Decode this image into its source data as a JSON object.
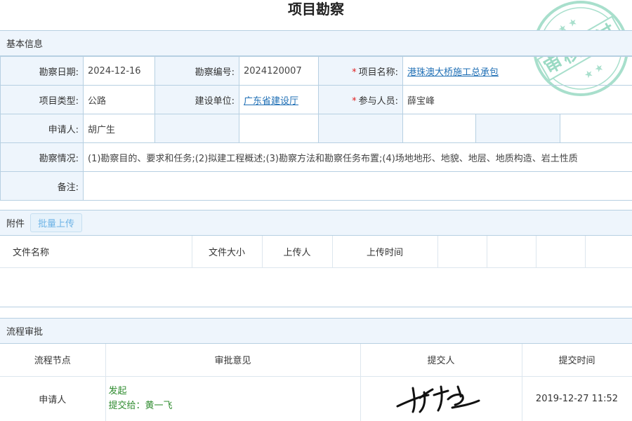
{
  "page": {
    "title": "项目勘察"
  },
  "stamp": {
    "text": "审核通过",
    "color": "#7fcfb4"
  },
  "basic": {
    "header": "基本信息",
    "survey_date_label": "勘察日期:",
    "survey_date": "2024-12-16",
    "survey_no_label": "勘察编号:",
    "survey_no": "2024120007",
    "project_name_label": "项目名称:",
    "project_name": "港珠澳大桥施工总承包",
    "project_type_label": "项目类型:",
    "project_type": "公路",
    "builder_label": "建设单位:",
    "builder": "广东省建设厅",
    "participants_label": "参与人员:",
    "participants": "薛宝峰",
    "applicant_label": "申请人:",
    "applicant": "胡广生",
    "situation_label": "勘察情况:",
    "situation": "(1)勘察目的、要求和任务;(2)拟建工程概述;(3)勘察方法和勘察任务布置;(4)场地地形、地貌、地层、地质构造、岩土性质",
    "remark_label": "备注:",
    "remark": "",
    "required_mark": "*"
  },
  "attachments": {
    "header": "附件",
    "upload_button": "批量上传",
    "columns": [
      "文件名称",
      "文件大小",
      "上传人",
      "上传时间"
    ]
  },
  "flow": {
    "header": "流程审批",
    "columns": [
      "流程节点",
      "审批意见",
      "提交人",
      "提交时间"
    ],
    "rows": [
      {
        "node": "申请人",
        "opinion_line1": "发起",
        "opinion_line2": "提交给：黄一飞",
        "submit_time": "2019-12-27 11:52"
      }
    ]
  }
}
